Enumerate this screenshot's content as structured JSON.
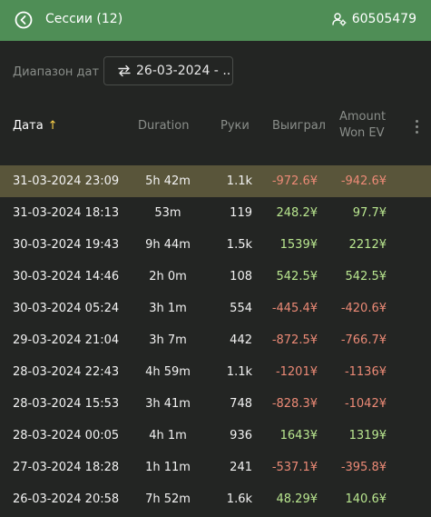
{
  "header": {
    "title": "Сессии (12)",
    "account_id": "60505479",
    "background": "#4f8e56"
  },
  "filter": {
    "label": "Диапазон дат",
    "date_range": "26-03-2024 - .."
  },
  "table": {
    "columns": {
      "date": "Дата",
      "duration": "Duration",
      "hands": "Руки",
      "won": "Выиграл",
      "ev_line1": "Amount",
      "ev_line2": "Won EV"
    },
    "sort_indicator": "↑",
    "rows": [
      {
        "date": "31-03-2024 23:09",
        "duration": "5h 42m",
        "hands": "1.1k",
        "won": "-972.6¥",
        "won_sign": "neg",
        "ev": "-942.6¥",
        "ev_sign": "neg",
        "selected": true
      },
      {
        "date": "31-03-2024 18:13",
        "duration": "53m",
        "hands": "119",
        "won": "248.2¥",
        "won_sign": "pos",
        "ev": "97.7¥",
        "ev_sign": "pos",
        "selected": false
      },
      {
        "date": "30-03-2024 19:43",
        "duration": "9h 44m",
        "hands": "1.5k",
        "won": "1539¥",
        "won_sign": "pos",
        "ev": "2212¥",
        "ev_sign": "pos",
        "selected": false
      },
      {
        "date": "30-03-2024 14:46",
        "duration": "2h 0m",
        "hands": "108",
        "won": "542.5¥",
        "won_sign": "pos",
        "ev": "542.5¥",
        "ev_sign": "pos",
        "selected": false
      },
      {
        "date": "30-03-2024 05:24",
        "duration": "3h 1m",
        "hands": "554",
        "won": "-445.4¥",
        "won_sign": "neg",
        "ev": "-420.6¥",
        "ev_sign": "neg",
        "selected": false
      },
      {
        "date": "29-03-2024 21:04",
        "duration": "3h 7m",
        "hands": "442",
        "won": "-872.5¥",
        "won_sign": "neg",
        "ev": "-766.7¥",
        "ev_sign": "neg",
        "selected": false
      },
      {
        "date": "28-03-2024 22:43",
        "duration": "4h 59m",
        "hands": "1.1k",
        "won": "-1201¥",
        "won_sign": "neg",
        "ev": "-1136¥",
        "ev_sign": "neg",
        "selected": false
      },
      {
        "date": "28-03-2024 15:53",
        "duration": "3h 41m",
        "hands": "748",
        "won": "-828.3¥",
        "won_sign": "neg",
        "ev": "-1042¥",
        "ev_sign": "neg",
        "selected": false
      },
      {
        "date": "28-03-2024 00:05",
        "duration": "4h 1m",
        "hands": "936",
        "won": "1643¥",
        "won_sign": "pos",
        "ev": "1319¥",
        "ev_sign": "pos",
        "selected": false
      },
      {
        "date": "27-03-2024 18:28",
        "duration": "1h 11m",
        "hands": "241",
        "won": "-537.1¥",
        "won_sign": "neg",
        "ev": "-395.8¥",
        "ev_sign": "neg",
        "selected": false
      },
      {
        "date": "26-03-2024 20:58",
        "duration": "7h 52m",
        "hands": "1.6k",
        "won": "48.29¥",
        "won_sign": "pos",
        "ev": "140.6¥",
        "ev_sign": "pos",
        "selected": false
      }
    ]
  },
  "colors": {
    "positive": "#b9e68f",
    "negative": "#ec8a76",
    "selected_row": "#59553a",
    "background": "#232523"
  },
  "icons": {
    "back": "back-circle-icon",
    "account": "user-gear-icon",
    "swap": "swap-arrows-icon",
    "menu": "more-vertical-icon"
  }
}
